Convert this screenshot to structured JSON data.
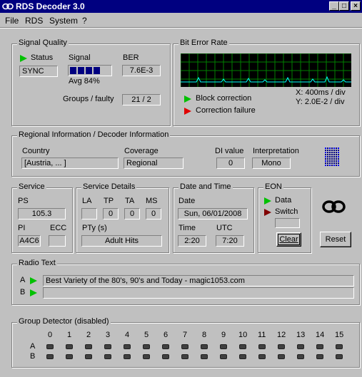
{
  "window": {
    "title": "RDS Decoder 3.0"
  },
  "menu": {
    "file": "File",
    "rds": "RDS",
    "system": "System",
    "help": "?"
  },
  "signal_quality": {
    "group_label": "Signal Quality",
    "status_label": "Status",
    "status_value": "SYNC",
    "signal_label": "Signal",
    "signal_level": 0.84,
    "avg_text": "Avg 84%",
    "ber_label": "BER",
    "ber_value": "7.6E-3",
    "groups_label": "Groups / faulty",
    "groups_value": "21 / 2"
  },
  "bit_error_rate": {
    "group_label": "Bit Error Rate",
    "block_correction": "Block correction",
    "correction_failure": "Correction failure",
    "x_scale": "X: 400ms / div",
    "y_scale": "Y: 2.0E-2 / div",
    "colors": {
      "grid": "#008000",
      "background": "#000000",
      "trace": "#00ffff"
    }
  },
  "regional": {
    "group_label": "Regional Information / Decoder Information",
    "country_label": "Country",
    "country_value": "[Austria, ... ]",
    "coverage_label": "Coverage",
    "coverage_value": "Regional",
    "di_label": "DI value",
    "di_value": "0",
    "interp_label": "Interpretation",
    "interp_value": "Mono"
  },
  "service": {
    "group_label": "Service",
    "ps_label": "PS",
    "ps_value": "105.3",
    "pi_label": "PI",
    "pi_value": "A4C6",
    "ecc_label": "ECC",
    "ecc_value": ""
  },
  "service_details": {
    "group_label": "Service Details",
    "la_label": "LA",
    "tp_label": "TP",
    "ta_label": "TA",
    "ms_label": "MS",
    "la_value": "",
    "tp_value": "0",
    "ta_value": "0",
    "ms_value": "0",
    "pty_label": "PTy (s)",
    "pty_value": "Adult Hits"
  },
  "date_time": {
    "group_label": "Date and Time",
    "date_label": "Date",
    "date_value": "Sun, 06/01/2008",
    "time_label": "Time",
    "time_value": "2:20",
    "utc_label": "UTC",
    "utc_value": "7:20"
  },
  "eon": {
    "group_label": "EON",
    "data_label": "Data",
    "switch_label": "Switch",
    "switch_value": "",
    "clear_label": "Clear"
  },
  "reset_label": "Reset",
  "radio_text": {
    "group_label": "Radio Text",
    "a_label": "A",
    "a_value": "Best Variety of the 80's, 90's and Today - magic1053.com",
    "b_label": "B",
    "b_value": ""
  },
  "group_detector": {
    "group_label": "Group Detector (disabled)",
    "columns": [
      "0",
      "1",
      "2",
      "3",
      "4",
      "5",
      "6",
      "7",
      "8",
      "9",
      "10",
      "11",
      "12",
      "13",
      "14",
      "15"
    ],
    "row_a": "A",
    "row_b": "B"
  }
}
